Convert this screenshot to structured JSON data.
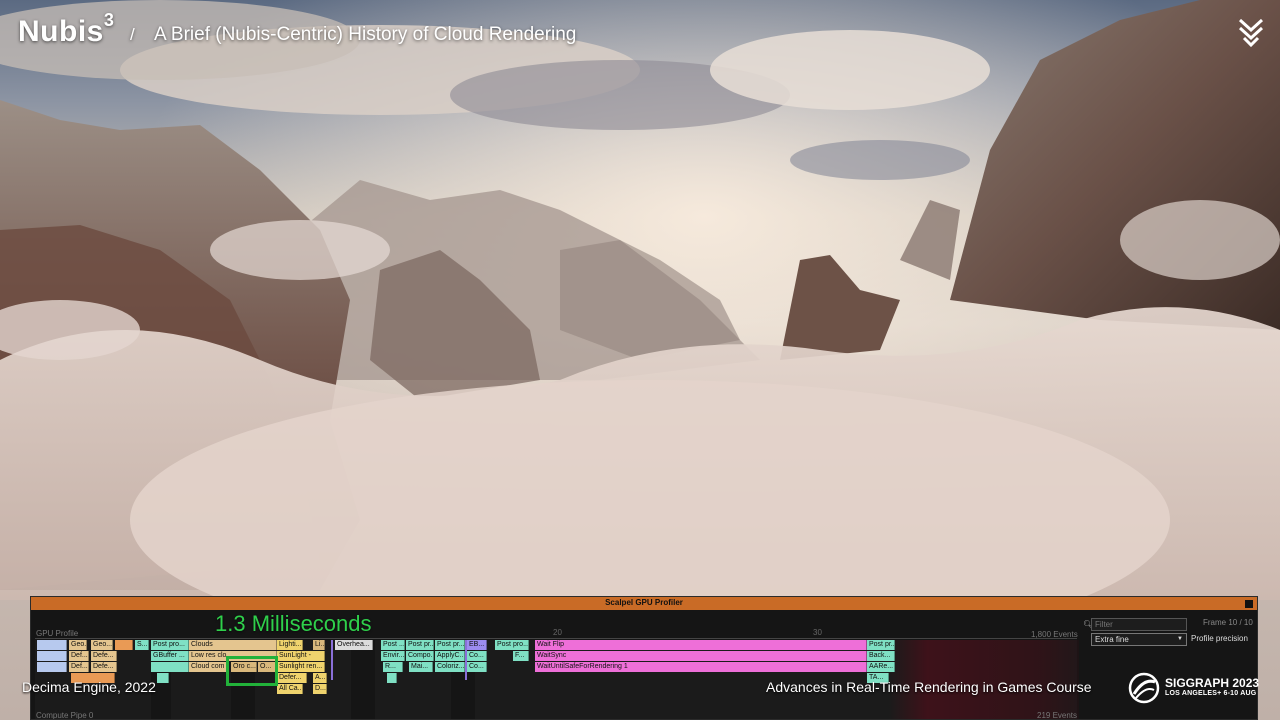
{
  "slide": {
    "title": "Nubis",
    "title_superscript": "3",
    "separator": "/",
    "subtitle": "A Brief (Nubis-Centric) History of Cloud Rendering"
  },
  "profiler": {
    "window_title": "Scalpel GPU Profiler",
    "gpu_profile_label": "GPU Profile",
    "compute_pipe_label": "Compute Pipe 0",
    "events_top": "1,800 Events",
    "events_bottom": "219 Events",
    "ticks": [
      "20",
      "30"
    ],
    "filter_placeholder": "Filter",
    "frame_label": "Frame 10 / 10",
    "precision_value": "Extra fine",
    "precision_label": "Profile precision",
    "row1": [
      "Geo...",
      "Geo...",
      "S...",
      "Post pro...",
      "Clouds",
      "Lighti...",
      "Li...",
      "Overhea...",
      "Post ...",
      "Post pr...",
      "Post pr...",
      "EB...",
      "Post pro...",
      "Wait Flip",
      "Post pr..."
    ],
    "row2": [
      "Def...",
      "Defe...",
      "GBuffer ...",
      "Low res clo",
      "SunLight -",
      "Envir...",
      "Compo...",
      "ApplyC...",
      "Co...",
      "F...",
      "WaitSync",
      "Back..."
    ],
    "row3": [
      "Def...",
      "Defe...",
      "Cloud com",
      "Oro c...",
      "O...",
      "Sunlight ren...",
      "R...",
      "Mai...",
      "Coloriz...",
      "Co...",
      "WaitUntilSafeForRendering 1",
      "AARe..."
    ],
    "row4": [
      "Defer...",
      "A..."
    ],
    "row5": [
      "All Ca...",
      "D...",
      "TA..."
    ]
  },
  "annotation": {
    "milliseconds_label": "1.3 Milliseconds"
  },
  "footer": {
    "left": "Decima Engine, 2022",
    "right": "Advances in Real-Time Rendering in Games Course",
    "siggraph_title": "SIGGRAPH 2023",
    "siggraph_sub": "LOS ANGELES+ 6-10 AUG"
  },
  "colors": {
    "accent_orange": "#c96b26",
    "annotation_green": "#2fd04b",
    "wait_pink": "#ee6fd8",
    "teal": "#7fe0c4",
    "tan": "#e4c58f"
  }
}
